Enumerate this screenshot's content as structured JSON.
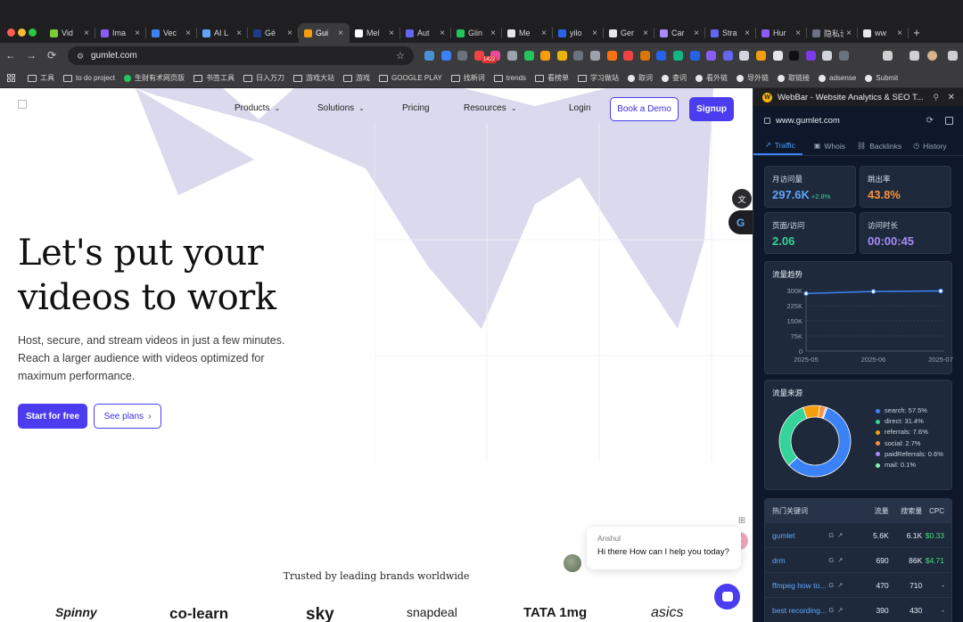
{
  "browser": {
    "tabs": [
      {
        "title": "Vid",
        "fav": "#7ecb3a"
      },
      {
        "title": "Ima",
        "fav": "#8b5cf6"
      },
      {
        "title": "Vec",
        "fav": "#3b82f6"
      },
      {
        "title": "AI L",
        "fav": "#60a5fa"
      },
      {
        "title": "Gé",
        "fav": "#1e3a8a"
      },
      {
        "title": "Gui",
        "fav": "#f59e0b",
        "active": true
      },
      {
        "title": "Mel",
        "fav": "#ffffff"
      },
      {
        "title": "Aut",
        "fav": "#6366f1"
      },
      {
        "title": "Glin",
        "fav": "#22c55e"
      },
      {
        "title": "Me",
        "fav": "#e5e7eb"
      },
      {
        "title": "yilo",
        "fav": "#2563eb"
      },
      {
        "title": "Ger",
        "fav": "#e5e7eb"
      },
      {
        "title": "Car",
        "fav": "#a78bfa"
      },
      {
        "title": "Stra",
        "fav": "#6366f1"
      },
      {
        "title": "Hur",
        "fav": "#8b5cf6"
      },
      {
        "title": "隐私设置",
        "fav": "#6b7280"
      },
      {
        "title": "ww",
        "fav": "#e5e7eb"
      }
    ],
    "url": "gumlet.com",
    "ext_badge": "1422",
    "bookmarks": [
      {
        "label": "工具",
        "kind": "folder"
      },
      {
        "label": "to do project",
        "kind": "folder"
      },
      {
        "label": "生财有术网页版",
        "kind": "dot",
        "color": "#22c55e"
      },
      {
        "label": "书签工具",
        "kind": "folder"
      },
      {
        "label": "日入万刀",
        "kind": "folder"
      },
      {
        "label": "游戏大站",
        "kind": "folder"
      },
      {
        "label": "游戏",
        "kind": "folder"
      },
      {
        "label": "GOOGLE PLAY",
        "kind": "folder"
      },
      {
        "label": "找新词",
        "kind": "folder"
      },
      {
        "label": "trends",
        "kind": "folder"
      },
      {
        "label": "看榜单",
        "kind": "folder"
      },
      {
        "label": "学习做站",
        "kind": "folder"
      },
      {
        "label": "取词",
        "kind": "dot",
        "color": "#e5e7eb"
      },
      {
        "label": "查词",
        "kind": "dot",
        "color": "#e5e7eb"
      },
      {
        "label": "看外链",
        "kind": "dot",
        "color": "#e5e7eb"
      },
      {
        "label": "导外链",
        "kind": "dot",
        "color": "#e5e7eb"
      },
      {
        "label": "取链接",
        "kind": "dot",
        "color": "#e5e7eb"
      },
      {
        "label": "adsense",
        "kind": "dot",
        "color": "#e5e7eb"
      },
      {
        "label": "Submit",
        "kind": "dot",
        "color": "#e5e7eb"
      }
    ]
  },
  "site": {
    "nav": {
      "products": "Products",
      "solutions": "Solutions",
      "pricing": "Pricing",
      "resources": "Resources",
      "login": "Login",
      "demo": "Book a Demo",
      "signup": "Signup"
    },
    "hero": {
      "line1": "Let's put your",
      "line2": "videos to work",
      "subtitle": "Host, secure, and stream videos in just a few minutes. Reach a larger audience with videos optimized for maximum performance.",
      "cta_primary": "Start for free",
      "cta_secondary": "See plans"
    },
    "trusted": "Trusted by leading brands worldwide",
    "logos": [
      "Spinny",
      "co-learn",
      "sky",
      "snapdeal",
      "TATA 1mg",
      "asics"
    ],
    "chat": {
      "agent": "Anshul",
      "message": "Hi there How can I help you today?"
    },
    "accent": "#4b3cf0"
  },
  "webbar": {
    "title": "WebBar - Website Analytics & SEO T...",
    "domain": "www.gumlet.com",
    "tabs": [
      "Traffic",
      "Whois",
      "Backlinks",
      "History"
    ],
    "stats": [
      {
        "label": "月访问量",
        "value": "297.6K",
        "delta": "+2.8%",
        "color": "#60a5fa"
      },
      {
        "label": "跳出率",
        "value": "43.8%",
        "color": "#fb923c"
      },
      {
        "label": "页面/访问",
        "value": "2.06",
        "color": "#34d399"
      },
      {
        "label": "访问时长",
        "value": "00:00:45",
        "color": "#a78bfa"
      }
    ],
    "trend_title": "流量趋势",
    "sources_title": "流量来源",
    "keywords": {
      "title": "热门关键词",
      "cols": [
        "流量",
        "搜索量",
        "CPC"
      ],
      "rows": [
        {
          "kw": "gumlet",
          "traffic": "5.6K",
          "volume": "6.1K",
          "cpc": "$0.33"
        },
        {
          "kw": "drm",
          "traffic": "690",
          "volume": "86K",
          "cpc": "$4.71"
        },
        {
          "kw": "ffmpeg how to...",
          "traffic": "470",
          "volume": "710",
          "cpc": "-"
        },
        {
          "kw": "best recording...",
          "traffic": "390",
          "volume": "430",
          "cpc": "-"
        }
      ]
    }
  },
  "chart_data": [
    {
      "type": "line",
      "title": "流量趋势",
      "x": [
        "2025-05",
        "2025-06",
        "2025-07"
      ],
      "y_ticks": [
        "0",
        "75K",
        "150K",
        "225K",
        "300K"
      ],
      "values": [
        285000,
        295000,
        297600
      ],
      "ylim": [
        0,
        300000
      ],
      "grid": true,
      "color": "#3b82f6"
    },
    {
      "type": "pie",
      "title": "流量来源",
      "legend_position": "right",
      "slices": [
        {
          "name": "search",
          "label": "search: 57.5%",
          "value": 57.5,
          "color": "#3b82f6"
        },
        {
          "name": "direct",
          "label": "direct: 31.4%",
          "value": 31.4,
          "color": "#34d399"
        },
        {
          "name": "referrals",
          "label": "referrals: 7.6%",
          "value": 7.6,
          "color": "#f59e0b"
        },
        {
          "name": "social",
          "label": "social: 2.7%",
          "value": 2.7,
          "color": "#fb923c"
        },
        {
          "name": "paidReferrals",
          "label": "paidReferrals: 0.6%",
          "value": 0.6,
          "color": "#a78bfa"
        },
        {
          "name": "mail",
          "label": "mail: 0.1%",
          "value": 0.1,
          "color": "#86efac"
        }
      ]
    }
  ]
}
